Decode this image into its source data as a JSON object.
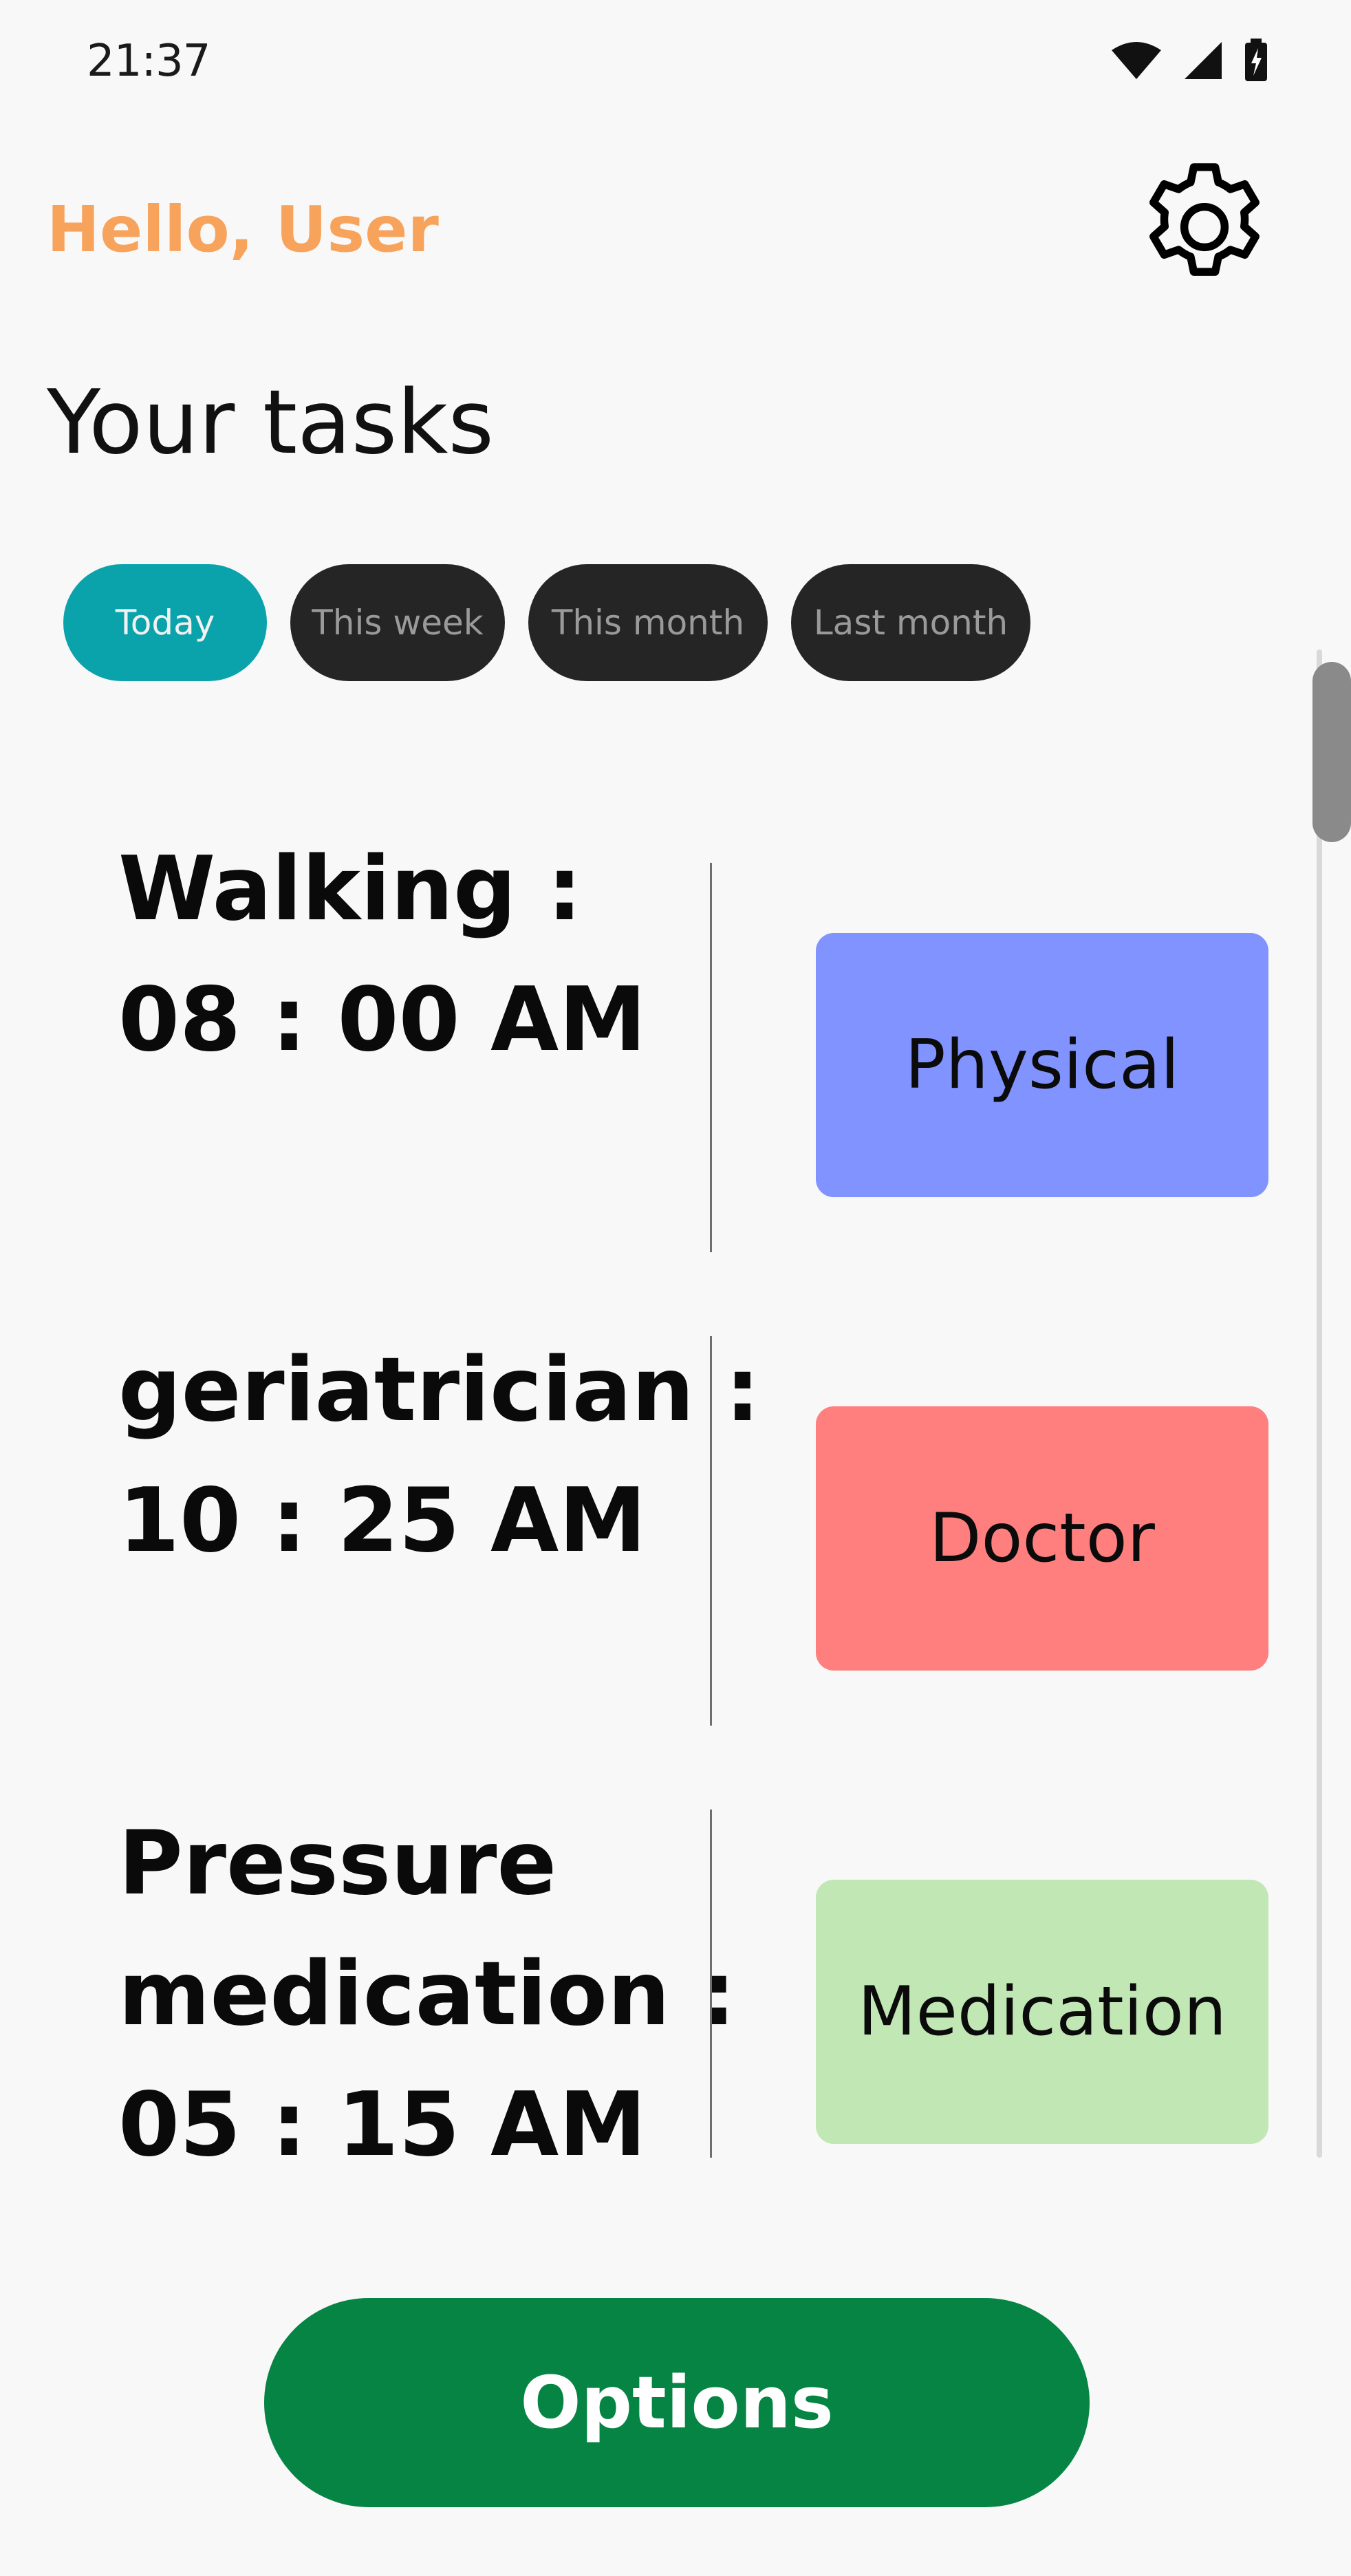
{
  "status_bar": {
    "time": "21:37",
    "icons": [
      "wifi-icon",
      "signal-icon",
      "battery-charging-icon"
    ]
  },
  "header": {
    "greeting": "Hello, User",
    "settings_icon": "gear-icon"
  },
  "page_title": "Your tasks",
  "filters": {
    "selected": "Today",
    "items": [
      "Today",
      "This week",
      "This month",
      "Last month"
    ]
  },
  "tasks": [
    {
      "text": "Walking :\n08 : 00 AM",
      "category": "Physical",
      "category_color": "#8093fe"
    },
    {
      "text": "geriatrician :\n10 : 25 AM",
      "category": "Doctor",
      "category_color": "#ff7e7e"
    },
    {
      "text": "Pressure\nmedication :\n05 : 15 AM",
      "category": "Medication",
      "category_color": "#c1e7b5"
    }
  ],
  "footer": {
    "options_label": "Options"
  },
  "colors": {
    "greeting": "#f7a35c",
    "chip_active": "#0aa3ac",
    "chip_inactive": "#252525",
    "options_button": "#068444"
  }
}
